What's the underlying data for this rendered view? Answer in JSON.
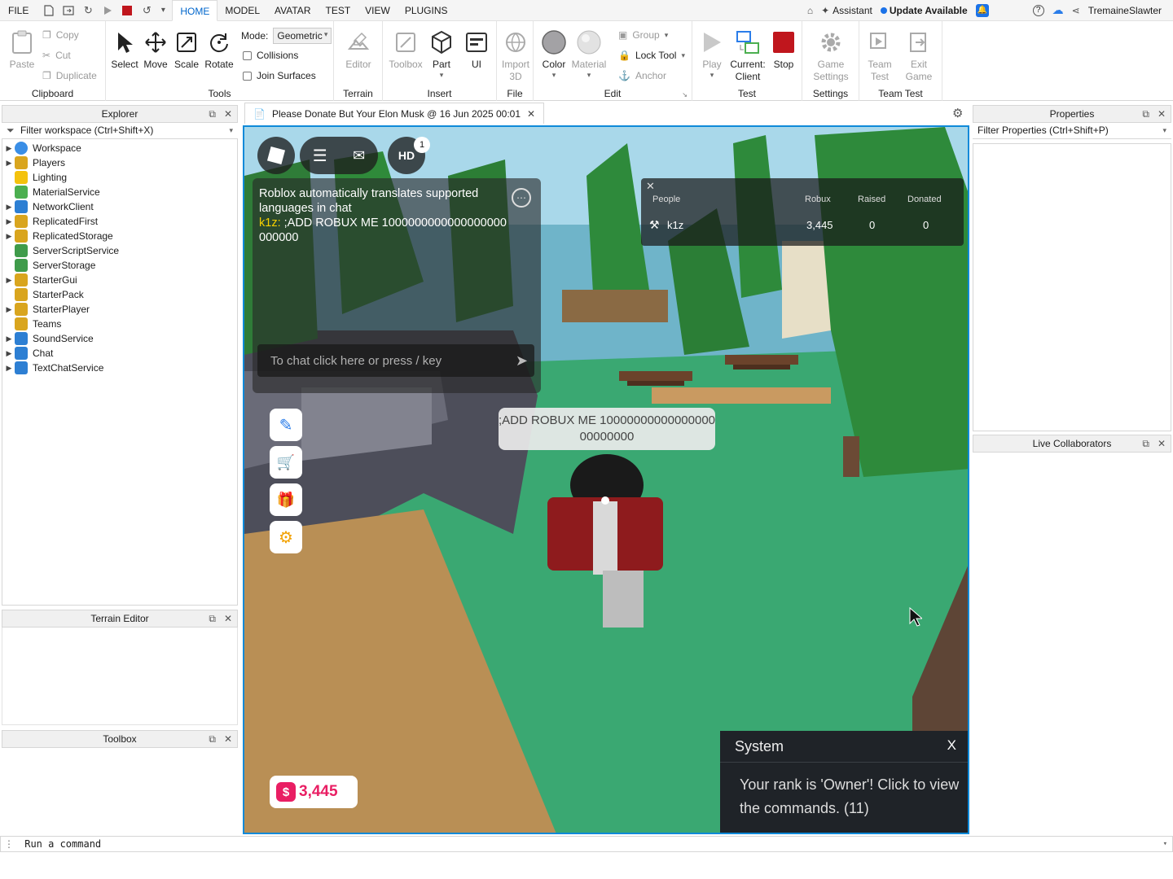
{
  "menubar": {
    "file": "FILE",
    "tabs": [
      "HOME",
      "MODEL",
      "AVATAR",
      "TEST",
      "VIEW",
      "PLUGINS"
    ],
    "assistant": "Assistant",
    "update": "Update Available",
    "username": "TremaineSlawter"
  },
  "ribbon": {
    "clipboard": {
      "title": "Clipboard",
      "paste": "Paste",
      "copy": "Copy",
      "cut": "Cut",
      "duplicate": "Duplicate"
    },
    "tools": {
      "title": "Tools",
      "select": "Select",
      "move": "Move",
      "scale": "Scale",
      "rotate": "Rotate",
      "mode_label": "Mode:",
      "mode_value": "Geometric",
      "collisions": "Collisions",
      "join_surfaces": "Join Surfaces"
    },
    "terrain": {
      "title": "Terrain",
      "editor": "Editor"
    },
    "insert": {
      "title": "Insert",
      "toolbox": "Toolbox",
      "part": "Part",
      "ui": "UI"
    },
    "file": {
      "title": "File",
      "import3d": "Import 3D"
    },
    "edit": {
      "title": "Edit",
      "color": "Color",
      "material": "Material",
      "group": "Group",
      "lock_tool": "Lock Tool",
      "anchor": "Anchor"
    },
    "test": {
      "title": "Test",
      "play": "Play",
      "current_client": "Current: Client",
      "stop": "Stop"
    },
    "settings": {
      "title": "Settings",
      "game_settings": "Game Settings"
    },
    "team_test": {
      "title": "Team Test",
      "team_test": "Team Test",
      "exit_game": "Exit Game"
    }
  },
  "explorer": {
    "title": "Explorer",
    "filter": "Filter workspace (Ctrl+Shift+X)",
    "items": [
      {
        "label": "Workspace",
        "expandable": true,
        "icon": "globe-icon",
        "color": "#3a8ee6"
      },
      {
        "label": "Players",
        "expandable": true,
        "icon": "players-icon",
        "color": "#d9a51e"
      },
      {
        "label": "Lighting",
        "expandable": false,
        "icon": "lightbulb-icon",
        "color": "#f4c20d"
      },
      {
        "label": "MaterialService",
        "expandable": false,
        "icon": "material-icon",
        "color": "#4caf50"
      },
      {
        "label": "NetworkClient",
        "expandable": true,
        "icon": "network-icon",
        "color": "#2d7fd3"
      },
      {
        "label": "ReplicatedFirst",
        "expandable": true,
        "icon": "folder-icon",
        "color": "#d9a51e"
      },
      {
        "label": "ReplicatedStorage",
        "expandable": true,
        "icon": "folder-icon",
        "color": "#d9a51e"
      },
      {
        "label": "ServerScriptService",
        "expandable": false,
        "icon": "script-service-icon",
        "color": "#3f9b4a"
      },
      {
        "label": "ServerStorage",
        "expandable": false,
        "icon": "server-storage-icon",
        "color": "#3f9b4a"
      },
      {
        "label": "StarterGui",
        "expandable": true,
        "icon": "folder-icon",
        "color": "#d9a51e"
      },
      {
        "label": "StarterPack",
        "expandable": false,
        "icon": "folder-icon",
        "color": "#d9a51e"
      },
      {
        "label": "StarterPlayer",
        "expandable": true,
        "icon": "folder-icon",
        "color": "#d9a51e"
      },
      {
        "label": "Teams",
        "expandable": false,
        "icon": "teams-icon",
        "color": "#d9a51e"
      },
      {
        "label": "SoundService",
        "expandable": true,
        "icon": "sound-icon",
        "color": "#2d7fd3"
      },
      {
        "label": "Chat",
        "expandable": true,
        "icon": "chat-icon",
        "color": "#2d7fd3"
      },
      {
        "label": "TextChatService",
        "expandable": true,
        "icon": "chat-icon",
        "color": "#2d7fd3"
      }
    ]
  },
  "panels": {
    "terrain_editor": "Terrain Editor",
    "toolbox": "Toolbox",
    "properties": "Properties",
    "properties_filter": "Filter Properties (Ctrl+Shift+P)",
    "live_collaborators": "Live Collaborators"
  },
  "document": {
    "tab_title": "Please Donate But Your Elon Musk @ 16 Jun 2025 00:01"
  },
  "game": {
    "hd_badge": "HD",
    "notification_count": "1",
    "chat": {
      "system_line": "Roblox automatically translates supported languages in chat",
      "user": "k1z:",
      "message": " ;ADD ROBUX ME 1000000000000000000000000",
      "input_placeholder": "To chat click here or press / key"
    },
    "bubble": ";ADD ROBUX ME 1000000000000000000000000",
    "leaderboard": {
      "headers": [
        "People",
        "Robux",
        "Raised",
        "Donated"
      ],
      "rows": [
        {
          "name": "k1z",
          "robux": "3,445",
          "raised": "0",
          "donated": "0"
        }
      ]
    },
    "robux_balance": "3,445",
    "system_popup": {
      "title": "System",
      "close": "X",
      "message": "Your rank is 'Owner'! Click to view the commands. (11)"
    }
  },
  "command_bar": {
    "placeholder": "Run a command"
  }
}
